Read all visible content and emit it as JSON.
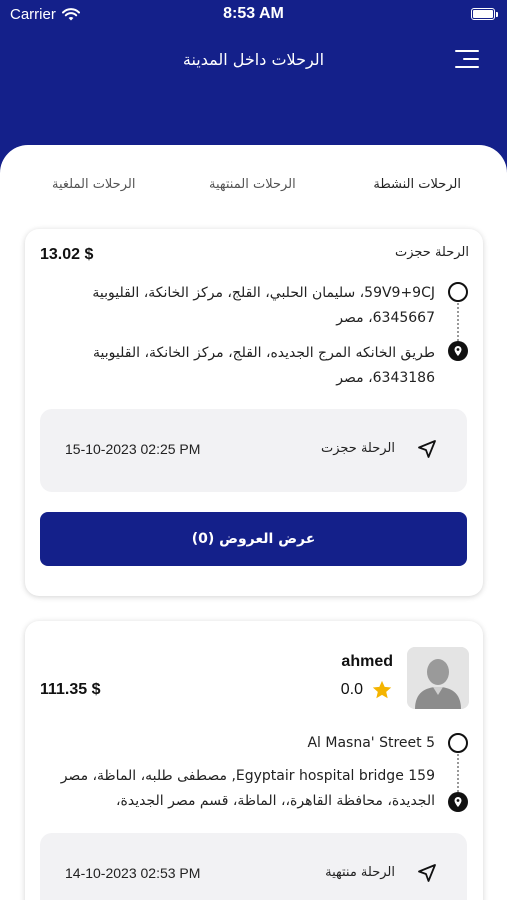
{
  "status_bar": {
    "carrier": "Carrier",
    "time": "8:53 AM",
    "battery_level": 1.0
  },
  "header": {
    "title": "الرحلات داخل المدينة",
    "menu_icon": "hamburger-menu-icon"
  },
  "tabs": [
    {
      "label": "الرحلات النشطة",
      "active": true
    },
    {
      "label": "الرحلات المنتهية",
      "active": false
    },
    {
      "label": "الرحلات الملغية",
      "active": false
    }
  ],
  "trips": [
    {
      "status": "الرحلة حجزت",
      "price": "13.02 $",
      "pickup": "59V9+9CJ، سليمان الحلبي، القلج، مركز الخانكة، القليوبية 6345667، مصر",
      "dropoff": "طريق الخانكه المرج الجديده، القلج، مركز الخانكة، القليوبية 6343186، مصر",
      "info_status": "الرحلة حجزت",
      "datetime": "15-10-2023 02:25 PM",
      "offers_button": "عرض العروض (0)"
    },
    {
      "driver_name": "ahmed",
      "rating": "0.0",
      "price": "111.35 $",
      "pickup": "Al Masna' Street 5",
      "dropoff": "159 Egyptair hospital bridge, مصطفى طلبه، الماظة، مصر الجديدة، محافظة القاهرة،، الماظة، قسم مصر الجديدة،",
      "info_status": "الرحلة منتهية",
      "datetime": "14-10-2023 02:53 PM"
    }
  ],
  "colors": {
    "primary": "#14208a",
    "star": "#f4b400",
    "info_box": "#f2f2f4"
  }
}
